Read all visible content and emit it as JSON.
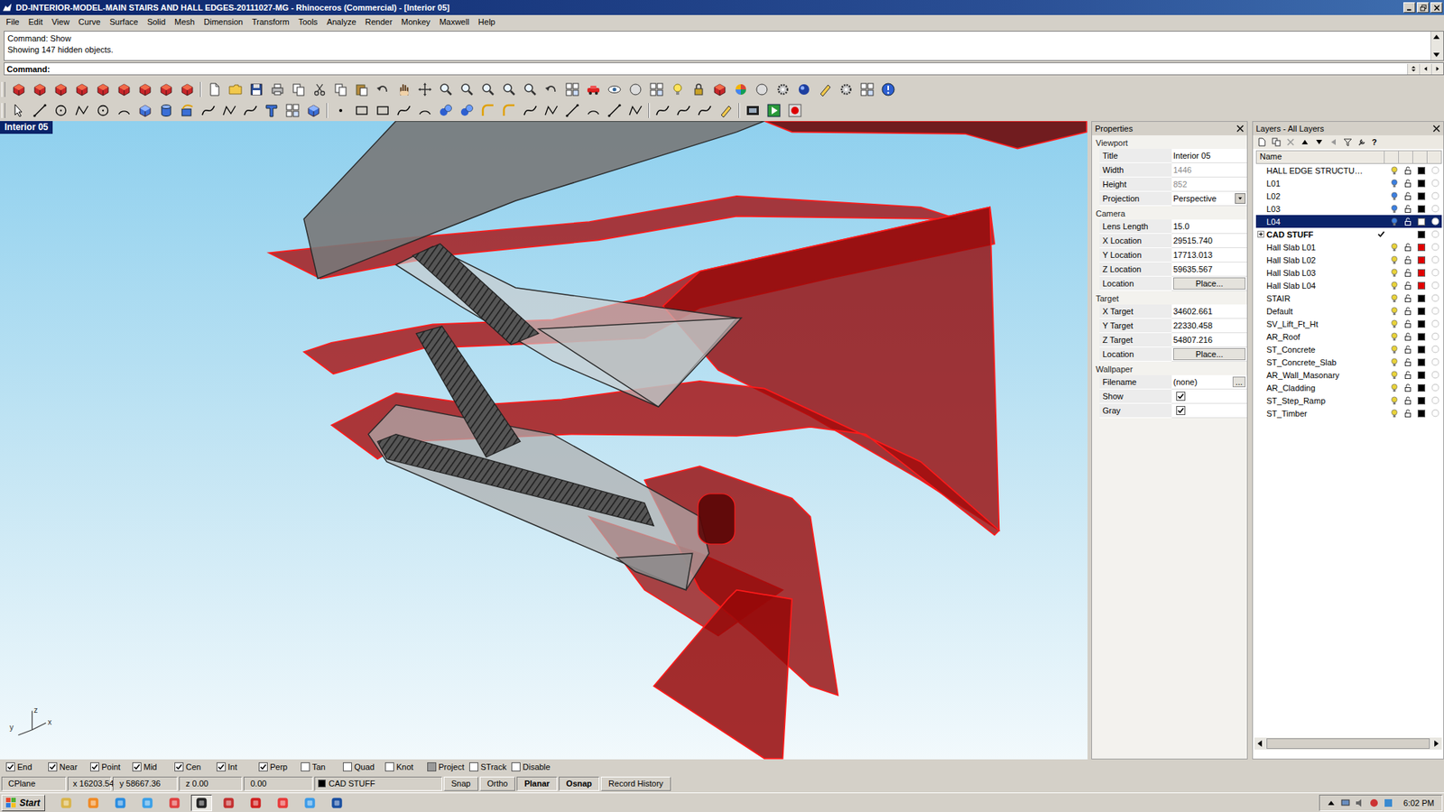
{
  "window": {
    "title": "DD-INTERIOR-MODEL-MAIN STAIRS AND HALL EDGES-20111027-MG - Rhinoceros (Commercial) - [Interior 05]"
  },
  "menu": [
    "File",
    "Edit",
    "View",
    "Curve",
    "Surface",
    "Solid",
    "Mesh",
    "Dimension",
    "Transform",
    "Tools",
    "Analyze",
    "Render",
    "Monkey",
    "Maxwell",
    "Help"
  ],
  "command_history": [
    "Command: Show",
    "Showing 147 hidden objects."
  ],
  "command_prompt": "Command:",
  "viewport": {
    "title": "Interior 05",
    "axes": {
      "z": "z",
      "y": "y",
      "x": "x"
    }
  },
  "properties": {
    "title": "Properties",
    "sections": [
      {
        "title": "Viewport",
        "rows": [
          {
            "label": "Title",
            "value": "Interior 05",
            "kind": "text",
            "disabled": false
          },
          {
            "label": "Width",
            "value": "1446",
            "kind": "text",
            "disabled": true
          },
          {
            "label": "Height",
            "value": "852",
            "kind": "text",
            "disabled": true
          },
          {
            "label": "Projection",
            "value": "Perspective",
            "kind": "dropdown",
            "disabled": false
          }
        ]
      },
      {
        "title": "Camera",
        "rows": [
          {
            "label": "Lens Length",
            "value": "15.0",
            "kind": "text",
            "disabled": false
          },
          {
            "label": "X Location",
            "value": "29515.740",
            "kind": "text",
            "disabled": false
          },
          {
            "label": "Y Location",
            "value": "17713.013",
            "kind": "text",
            "disabled": false
          },
          {
            "label": "Z Location",
            "value": "59635.567",
            "kind": "text",
            "disabled": false
          },
          {
            "label": "Location",
            "value": "Place...",
            "kind": "button",
            "disabled": false
          }
        ]
      },
      {
        "title": "Target",
        "rows": [
          {
            "label": "X Target",
            "value": "34602.661",
            "kind": "text",
            "disabled": false
          },
          {
            "label": "Y Target",
            "value": "22330.458",
            "kind": "text",
            "disabled": false
          },
          {
            "label": "Z Target",
            "value": "54807.216",
            "kind": "text",
            "disabled": false
          },
          {
            "label": "Location",
            "value": "Place...",
            "kind": "button",
            "disabled": false
          }
        ]
      },
      {
        "title": "Wallpaper",
        "rows": [
          {
            "label": "Filename",
            "value": "(none)",
            "kind": "file",
            "button_label": "...",
            "disabled": false
          },
          {
            "label": "Show",
            "value": "",
            "kind": "checkbox",
            "checked": true,
            "disabled": false
          },
          {
            "label": "Gray",
            "value": "",
            "kind": "checkbox",
            "checked": true,
            "disabled": false
          }
        ]
      }
    ]
  },
  "layers": {
    "title": "Layers - All Layers",
    "help": "?",
    "column": "Name",
    "items": [
      {
        "name": "HALL EDGE STRUCTU…",
        "kind": "layer",
        "selected": false,
        "current": false,
        "bold": false,
        "expandable": false,
        "expanded": false,
        "bulb_color": "#e8d23a",
        "color": "#000000"
      },
      {
        "name": "L01",
        "kind": "layer",
        "selected": false,
        "current": false,
        "bold": false,
        "expandable": false,
        "expanded": false,
        "bulb_color": "#3b7fe0",
        "color": "#000000"
      },
      {
        "name": "L02",
        "kind": "layer",
        "selected": false,
        "current": false,
        "bold": false,
        "expandable": false,
        "expanded": false,
        "bulb_color": "#3b7fe0",
        "color": "#000000"
      },
      {
        "name": "L03",
        "kind": "layer",
        "selected": false,
        "current": false,
        "bold": false,
        "expandable": false,
        "expanded": false,
        "bulb_color": "#3b7fe0",
        "color": "#000000"
      },
      {
        "name": "L04",
        "kind": "layer",
        "selected": true,
        "current": false,
        "bold": false,
        "expandable": false,
        "expanded": false,
        "bulb_color": "#3b7fe0",
        "color": "#ffffff"
      },
      {
        "name": "CAD STUFF",
        "kind": "group",
        "selected": false,
        "current": true,
        "bold": true,
        "expandable": true,
        "expanded": false,
        "bulb_color": "#e8d23a",
        "color": "#000000"
      },
      {
        "name": "Hall Slab L01",
        "kind": "layer",
        "selected": false,
        "current": false,
        "bold": false,
        "expandable": false,
        "expanded": false,
        "bulb_color": "#e8d23a",
        "color": "#e00000"
      },
      {
        "name": "Hall Slab L02",
        "kind": "layer",
        "selected": false,
        "current": false,
        "bold": false,
        "expandable": false,
        "expanded": false,
        "bulb_color": "#e8d23a",
        "color": "#e00000"
      },
      {
        "name": "Hall Slab L03",
        "kind": "layer",
        "selected": false,
        "current": false,
        "bold": false,
        "expandable": false,
        "expanded": false,
        "bulb_color": "#e8d23a",
        "color": "#e00000"
      },
      {
        "name": "Hall Slab L04",
        "kind": "layer",
        "selected": false,
        "current": false,
        "bold": false,
        "expandable": false,
        "expanded": false,
        "bulb_color": "#e8d23a",
        "color": "#e00000"
      },
      {
        "name": "STAIR",
        "kind": "layer",
        "selected": false,
        "current": false,
        "bold": false,
        "expandable": false,
        "expanded": false,
        "bulb_color": "#e8d23a",
        "color": "#000000"
      },
      {
        "name": "Default",
        "kind": "layer",
        "selected": false,
        "current": false,
        "bold": false,
        "expandable": false,
        "expanded": false,
        "bulb_color": "#e8d23a",
        "color": "#000000"
      },
      {
        "name": "SV_Lift_Ft_Ht",
        "kind": "layer",
        "selected": false,
        "current": false,
        "bold": false,
        "expandable": false,
        "expanded": false,
        "bulb_color": "#e8d23a",
        "color": "#000000"
      },
      {
        "name": "AR_Roof",
        "kind": "layer",
        "selected": false,
        "current": false,
        "bold": false,
        "expandable": false,
        "expanded": false,
        "bulb_color": "#e8d23a",
        "color": "#000000"
      },
      {
        "name": "ST_Concrete",
        "kind": "layer",
        "selected": false,
        "current": false,
        "bold": false,
        "expandable": false,
        "expanded": false,
        "bulb_color": "#e8d23a",
        "color": "#000000"
      },
      {
        "name": "ST_Concrete_Slab",
        "kind": "layer",
        "selected": false,
        "current": false,
        "bold": false,
        "expandable": false,
        "expanded": false,
        "bulb_color": "#e8d23a",
        "color": "#000000"
      },
      {
        "name": "AR_Wall_Masonary",
        "kind": "layer",
        "selected": false,
        "current": false,
        "bold": false,
        "expandable": false,
        "expanded": false,
        "bulb_color": "#e8d23a",
        "color": "#000000"
      },
      {
        "name": "AR_Cladding",
        "kind": "layer",
        "selected": false,
        "current": false,
        "bold": false,
        "expandable": false,
        "expanded": false,
        "bulb_color": "#e8d23a",
        "color": "#000000"
      },
      {
        "name": "ST_Step_Ramp",
        "kind": "layer",
        "selected": false,
        "current": false,
        "bold": false,
        "expandable": false,
        "expanded": false,
        "bulb_color": "#e8d23a",
        "color": "#000000"
      },
      {
        "name": "ST_Timber",
        "kind": "layer",
        "selected": false,
        "current": false,
        "bold": false,
        "expandable": false,
        "expanded": false,
        "bulb_color": "#e8d23a",
        "color": "#000000"
      }
    ]
  },
  "osnap": [
    {
      "label": "End",
      "checked": true,
      "mixed": false
    },
    {
      "label": "Near",
      "checked": true,
      "mixed": false
    },
    {
      "label": "Point",
      "checked": true,
      "mixed": false
    },
    {
      "label": "Mid",
      "checked": true,
      "mixed": false
    },
    {
      "label": "Cen",
      "checked": true,
      "mixed": false
    },
    {
      "label": "Int",
      "checked": true,
      "mixed": false
    },
    {
      "label": "Perp",
      "checked": true,
      "mixed": false
    },
    {
      "label": "Tan",
      "checked": false,
      "mixed": false
    },
    {
      "label": "Quad",
      "checked": false,
      "mixed": false
    },
    {
      "label": "Knot",
      "checked": false,
      "mixed": false
    },
    {
      "label": "Project",
      "checked": false,
      "mixed": true
    },
    {
      "label": "STrack",
      "checked": false,
      "mixed": false
    },
    {
      "label": "Disable",
      "checked": false,
      "mixed": false
    }
  ],
  "status_bar": {
    "cplane": "CPlane",
    "x": "x 16203.54",
    "y": "y 58667.36",
    "z": "z 0.00",
    "distance": "0.00",
    "layer": {
      "name": "CAD STUFF",
      "color": "#000000"
    },
    "toggles": [
      {
        "label": "Snap",
        "on": false
      },
      {
        "label": "Ortho",
        "on": false
      },
      {
        "label": "Planar",
        "on": true
      },
      {
        "label": "Osnap",
        "on": true
      },
      {
        "label": "Record History",
        "on": false
      }
    ]
  },
  "taskbar": {
    "start": "Start",
    "time": "6:02 PM",
    "apps": [
      {
        "selected": false
      },
      {
        "selected": false
      },
      {
        "selected": false
      },
      {
        "selected": false
      },
      {
        "selected": false
      },
      {
        "selected": true
      },
      {
        "selected": false
      },
      {
        "selected": false
      },
      {
        "selected": false
      },
      {
        "selected": false
      },
      {
        "selected": false
      }
    ]
  }
}
